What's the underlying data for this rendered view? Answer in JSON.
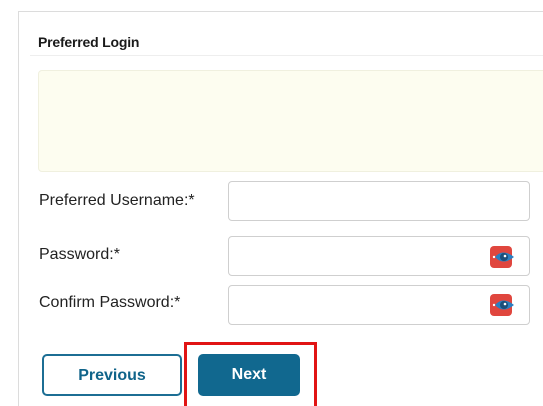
{
  "form": {
    "section_title": "Preferred Login",
    "fields": {
      "username": {
        "label": "Preferred Username:*",
        "value": "",
        "placeholder": ""
      },
      "password": {
        "label": "Password:*",
        "value": "",
        "placeholder": ""
      },
      "confirm_password": {
        "label": "Confirm Password:*",
        "value": "",
        "placeholder": ""
      }
    },
    "icons": {
      "password_visibility": "eye-toggle-icon",
      "confirm_password_visibility": "eye-toggle-icon"
    }
  },
  "buttons": {
    "previous_label": "Previous",
    "next_label": "Next"
  },
  "colors": {
    "primary": "#11688f",
    "notice_background": "#fdfdf0",
    "highlight": "#e11414",
    "eye_icon_red": "#e0463e",
    "eye_icon_blue": "#2a7fc1"
  }
}
